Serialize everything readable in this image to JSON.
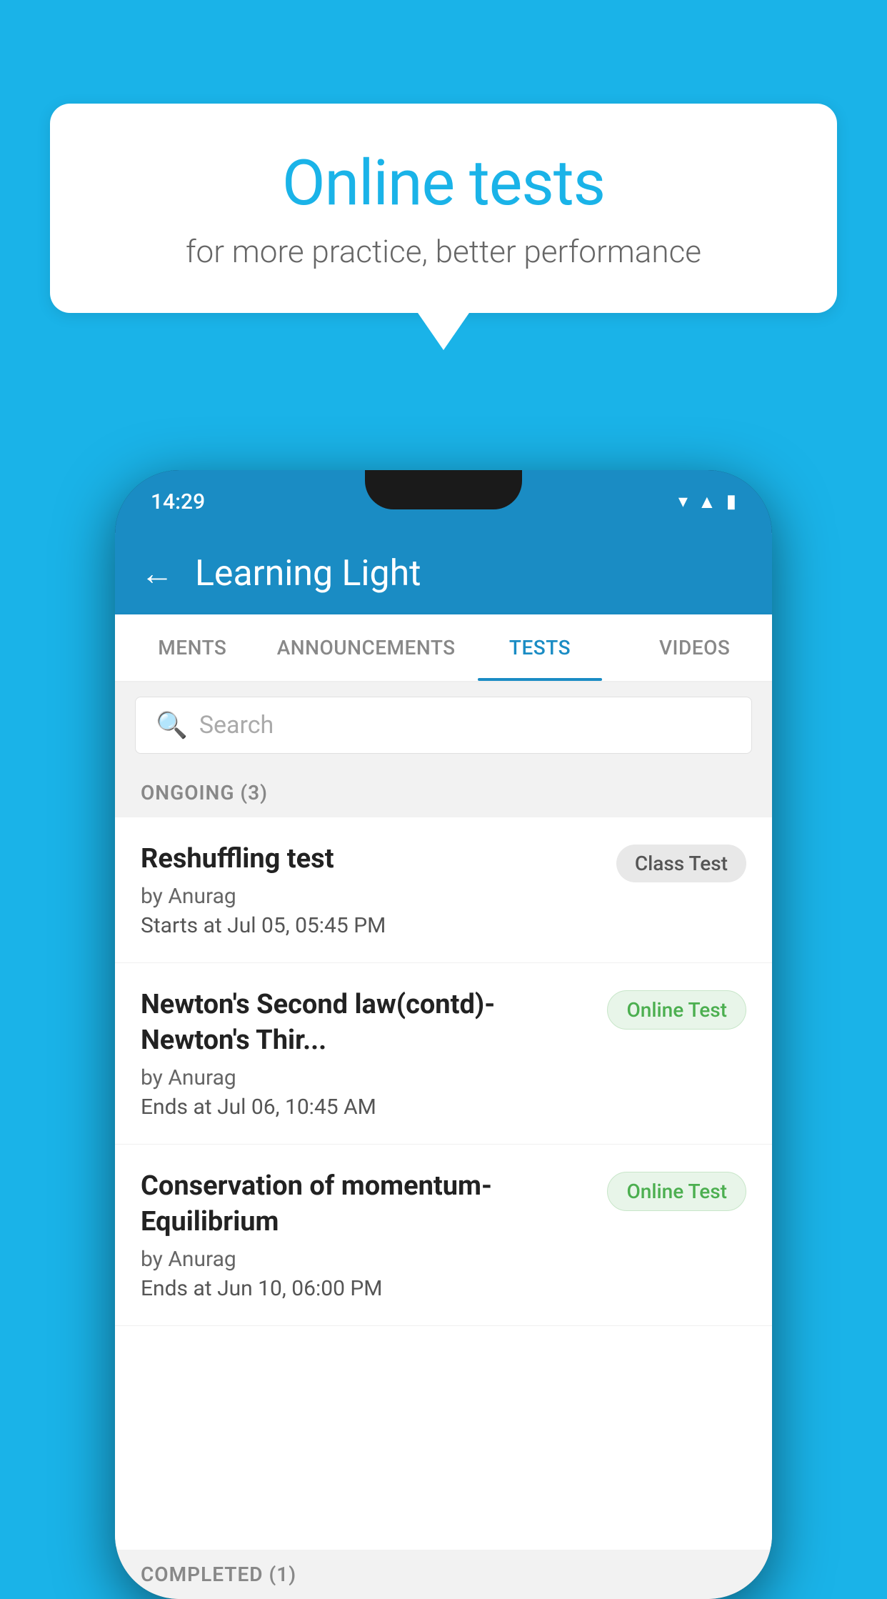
{
  "background": {
    "color": "#1ab3e8"
  },
  "speech_bubble": {
    "title": "Online tests",
    "subtitle": "for more practice, better performance"
  },
  "phone": {
    "status_bar": {
      "time": "14:29"
    },
    "app_header": {
      "title": "Learning Light",
      "back_label": "←"
    },
    "tabs": [
      {
        "label": "MENTS",
        "active": false
      },
      {
        "label": "ANNOUNCEMENTS",
        "active": false
      },
      {
        "label": "TESTS",
        "active": true
      },
      {
        "label": "VIDEOS",
        "active": false
      }
    ],
    "search": {
      "placeholder": "Search"
    },
    "ongoing_section": {
      "label": "ONGOING (3)"
    },
    "tests": [
      {
        "title": "Reshuffling test",
        "by": "by Anurag",
        "date_label": "Starts at",
        "date": "Jul 05, 05:45 PM",
        "badge": "Class Test",
        "badge_type": "class"
      },
      {
        "title": "Newton's Second law(contd)-Newton's Thir...",
        "by": "by Anurag",
        "date_label": "Ends at",
        "date": "Jul 06, 10:45 AM",
        "badge": "Online Test",
        "badge_type": "online"
      },
      {
        "title": "Conservation of momentum-Equilibrium",
        "by": "by Anurag",
        "date_label": "Ends at",
        "date": "Jun 10, 06:00 PM",
        "badge": "Online Test",
        "badge_type": "online"
      }
    ],
    "completed_section": {
      "label": "COMPLETED (1)"
    }
  }
}
